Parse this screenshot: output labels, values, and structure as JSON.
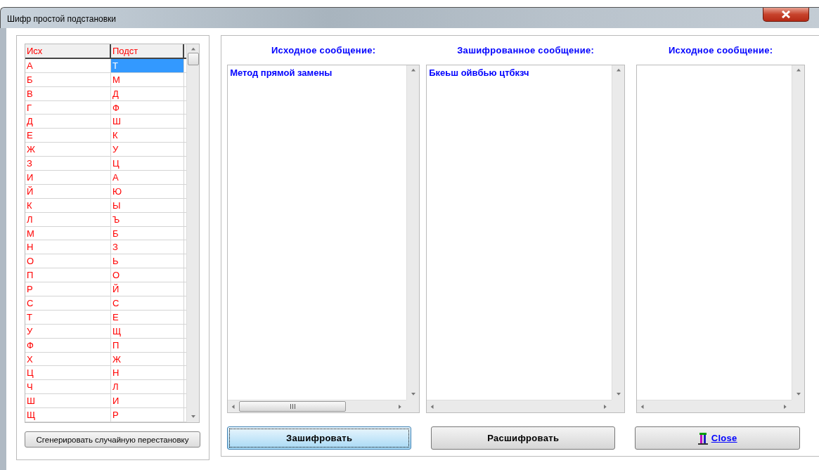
{
  "window": {
    "title": "Шифр простой подстановки"
  },
  "table": {
    "columns": [
      "Исх",
      "Подст"
    ],
    "rows": [
      {
        "cells": [
          "А",
          "Т"
        ],
        "selected": true
      },
      {
        "cells": [
          "Б",
          "М"
        ],
        "selected": false
      },
      {
        "cells": [
          "В",
          "Д"
        ],
        "selected": false
      },
      {
        "cells": [
          "Г",
          "Ф"
        ],
        "selected": false
      },
      {
        "cells": [
          "Д",
          "Ш"
        ],
        "selected": false
      },
      {
        "cells": [
          "Е",
          "К"
        ],
        "selected": false
      },
      {
        "cells": [
          "Ж",
          "У"
        ],
        "selected": false
      },
      {
        "cells": [
          "З",
          "Ц"
        ],
        "selected": false
      },
      {
        "cells": [
          "И",
          "А"
        ],
        "selected": false
      },
      {
        "cells": [
          "Й",
          "Ю"
        ],
        "selected": false
      },
      {
        "cells": [
          "К",
          "Ы"
        ],
        "selected": false
      },
      {
        "cells": [
          "Л",
          "Ъ"
        ],
        "selected": false
      },
      {
        "cells": [
          "М",
          "Б"
        ],
        "selected": false
      },
      {
        "cells": [
          "Н",
          "З"
        ],
        "selected": false
      },
      {
        "cells": [
          "О",
          "Ь"
        ],
        "selected": false
      },
      {
        "cells": [
          "П",
          "О"
        ],
        "selected": false
      },
      {
        "cells": [
          "Р",
          "Й"
        ],
        "selected": false
      },
      {
        "cells": [
          "С",
          "С"
        ],
        "selected": false
      },
      {
        "cells": [
          "Т",
          "Е"
        ],
        "selected": false
      },
      {
        "cells": [
          "У",
          "Щ"
        ],
        "selected": false
      },
      {
        "cells": [
          "Ф",
          "П"
        ],
        "selected": false
      },
      {
        "cells": [
          "Х",
          "Ж"
        ],
        "selected": false
      },
      {
        "cells": [
          "Ц",
          "Н"
        ],
        "selected": false
      },
      {
        "cells": [
          "Ч",
          "Л"
        ],
        "selected": false
      },
      {
        "cells": [
          "Ш",
          "И"
        ],
        "selected": false
      },
      {
        "cells": [
          "Щ",
          "Р"
        ],
        "selected": false
      }
    ]
  },
  "generate_button": "Сгенерировать случайную перестановку",
  "memos": [
    {
      "label": "Исходное сообщение:",
      "text": "Метод прямой замены"
    },
    {
      "label": "Зашифрованное сообщение:",
      "text": "Бкеьш ойвбью цтбкзч"
    },
    {
      "label": "Исходное сообщение:"
    }
  ],
  "buttons": [
    {
      "label": "Зашифровать",
      "focused": true
    },
    {
      "label": "Расшифровать",
      "focused": false
    },
    {
      "label": "Close",
      "focused": false,
      "kind": "close"
    }
  ]
}
